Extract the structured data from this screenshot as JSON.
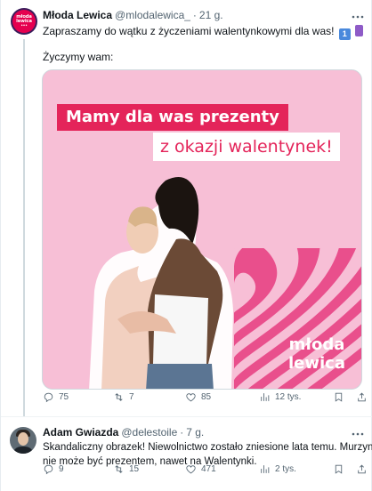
{
  "tweet1": {
    "name": "Młoda Lewica",
    "handle": "@mlodalewica_",
    "separator": "·",
    "time": "21 g.",
    "more_icon": "ellipsis-icon",
    "avatar_lines": [
      "młoda",
      "lewica",
      "•••"
    ],
    "text_line1": "Zapraszamy do wątku z życzeniami walentynkowymi dla was!",
    "emoji1": "1",
    "text_line2": "Życzymy wam:",
    "media": {
      "banner_line1": "Mamy dla was prezenty",
      "banner_line2": "z okazji walentynek!",
      "logo_line1": "młoda",
      "logo_line2": "lewica",
      "colors": {
        "pink_light": "#f7bfd6",
        "pink_dark": "#e94f8c",
        "banner_red": "#e4245a"
      }
    },
    "actions": {
      "replies": "75",
      "retweets": "7",
      "likes": "85",
      "views": "12 tys."
    }
  },
  "tweet2": {
    "name": "Adam Gwiazda",
    "handle": "@delestoile",
    "separator": "·",
    "time": "7 g.",
    "text_line1": "Skandaliczny obrazek! Niewolnictwo zostało zniesione lata temu. Murzyn",
    "text_line2": "nie może być prezentem, nawet na Walentynki.",
    "actions": {
      "replies": "9",
      "retweets": "15",
      "likes": "471",
      "views": "2 tys."
    }
  },
  "icons": {
    "reply": "reply-icon",
    "retweet": "retweet-icon",
    "like": "heart-icon",
    "views": "views-icon",
    "bookmark": "bookmark-icon",
    "share": "share-icon"
  }
}
